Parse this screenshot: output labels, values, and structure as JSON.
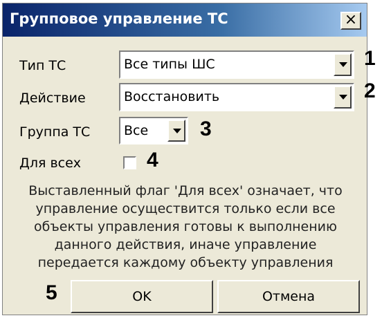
{
  "dialog": {
    "title": "Групповое управление ТС",
    "close_label": "✕"
  },
  "fields": {
    "ts_type": {
      "label": "Тип ТС",
      "value": "Все типы ШС",
      "marker": "1"
    },
    "action": {
      "label": "Действие",
      "value": "Восстановить",
      "marker": "2"
    },
    "ts_group": {
      "label": "Группа ТС",
      "value": "Все",
      "marker": "3"
    },
    "for_all": {
      "label": "Для всех",
      "checked": false,
      "marker": "4"
    }
  },
  "info_lines": [
    "Выставленный флаг 'Для всех' означает, что",
    "управление осуществится только если все",
    "объекты управления готовы к выполнению",
    "данного действия, иначе управление",
    "передается каждому объекту управления"
  ],
  "buttons": {
    "marker": "5",
    "ok": "OK",
    "cancel": "Отмена"
  }
}
